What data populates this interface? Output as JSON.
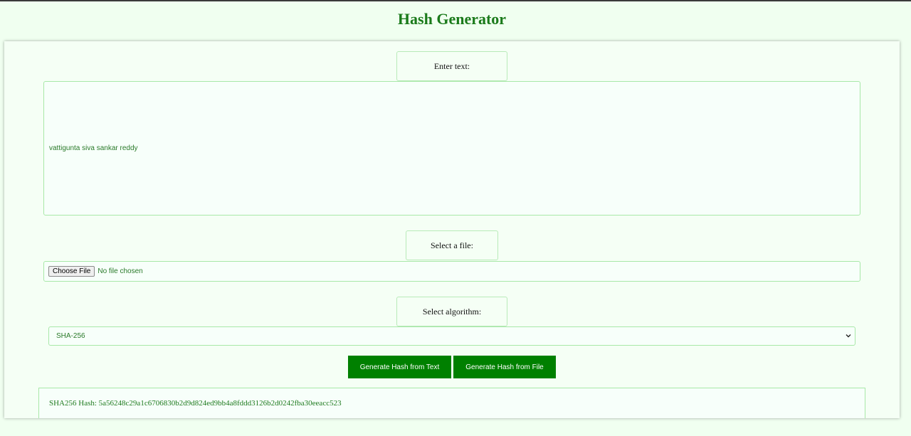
{
  "page": {
    "title": "Hash Generator"
  },
  "text_section": {
    "label": "Enter text:",
    "value": "vattigunta siva sankar reddy"
  },
  "file_section": {
    "label": "Select a file:",
    "button_label": "Choose File",
    "status": "No file chosen"
  },
  "algorithm_section": {
    "label": "Select algorithm:",
    "selected": "SHA-256"
  },
  "actions": {
    "text_button": "Generate Hash from Text",
    "file_button": "Generate Hash from File"
  },
  "result": {
    "text": "SHA256 Hash: 5a56248c29a1c6706830b2d9d824ed9bb4a8fddd3126b2d0242fba30eeacc523"
  },
  "colors": {
    "accent": "#008000",
    "title": "#1a7a1a",
    "background": "#f0fff0",
    "border": "#a8e8a8"
  }
}
